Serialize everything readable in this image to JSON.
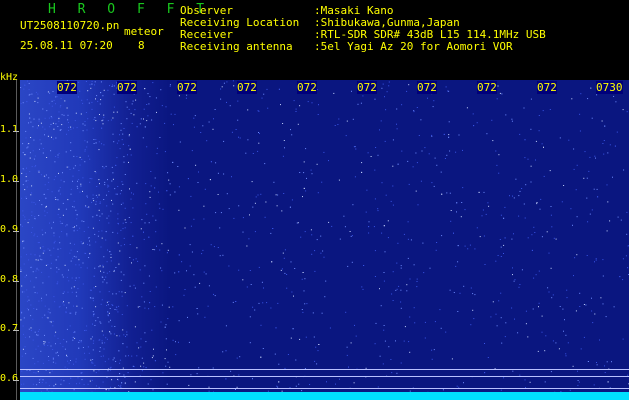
{
  "header": {
    "brand": "H R O F F T",
    "filename": "UT2508110720.pn",
    "meteor_label": "meteor",
    "datetime": "25.08.11 07:20",
    "speed": "8",
    "info": [
      {
        "key": "Observer",
        "value": ":Masaki Kano"
      },
      {
        "key": "Receiving Location",
        "value": ":Shibukawa,Gunma,Japan"
      },
      {
        "key": "Receiver",
        "value": ":RTL-SDR SDR# 43dB L15 114.1MHz USB"
      },
      {
        "key": "Receiving antenna",
        "value": ":5el Yagi Az 20 for Aomori VOR"
      }
    ]
  },
  "time_axis": {
    "labels": [
      "072",
      "072",
      "072",
      "072",
      "072",
      "072",
      "072",
      "072",
      "072",
      "0730"
    ]
  },
  "freq_axis": {
    "unit": "kHz",
    "labels": [
      "1.1",
      "1.0",
      "0.9",
      "0.8",
      "0.7",
      "0.6"
    ]
  },
  "colors": {
    "background": "#000000",
    "header_text": "#ffff00",
    "brand_text": "#19c81e",
    "waterfall_base": "#0a1680",
    "waterfall_noise": "#4c6cff"
  }
}
